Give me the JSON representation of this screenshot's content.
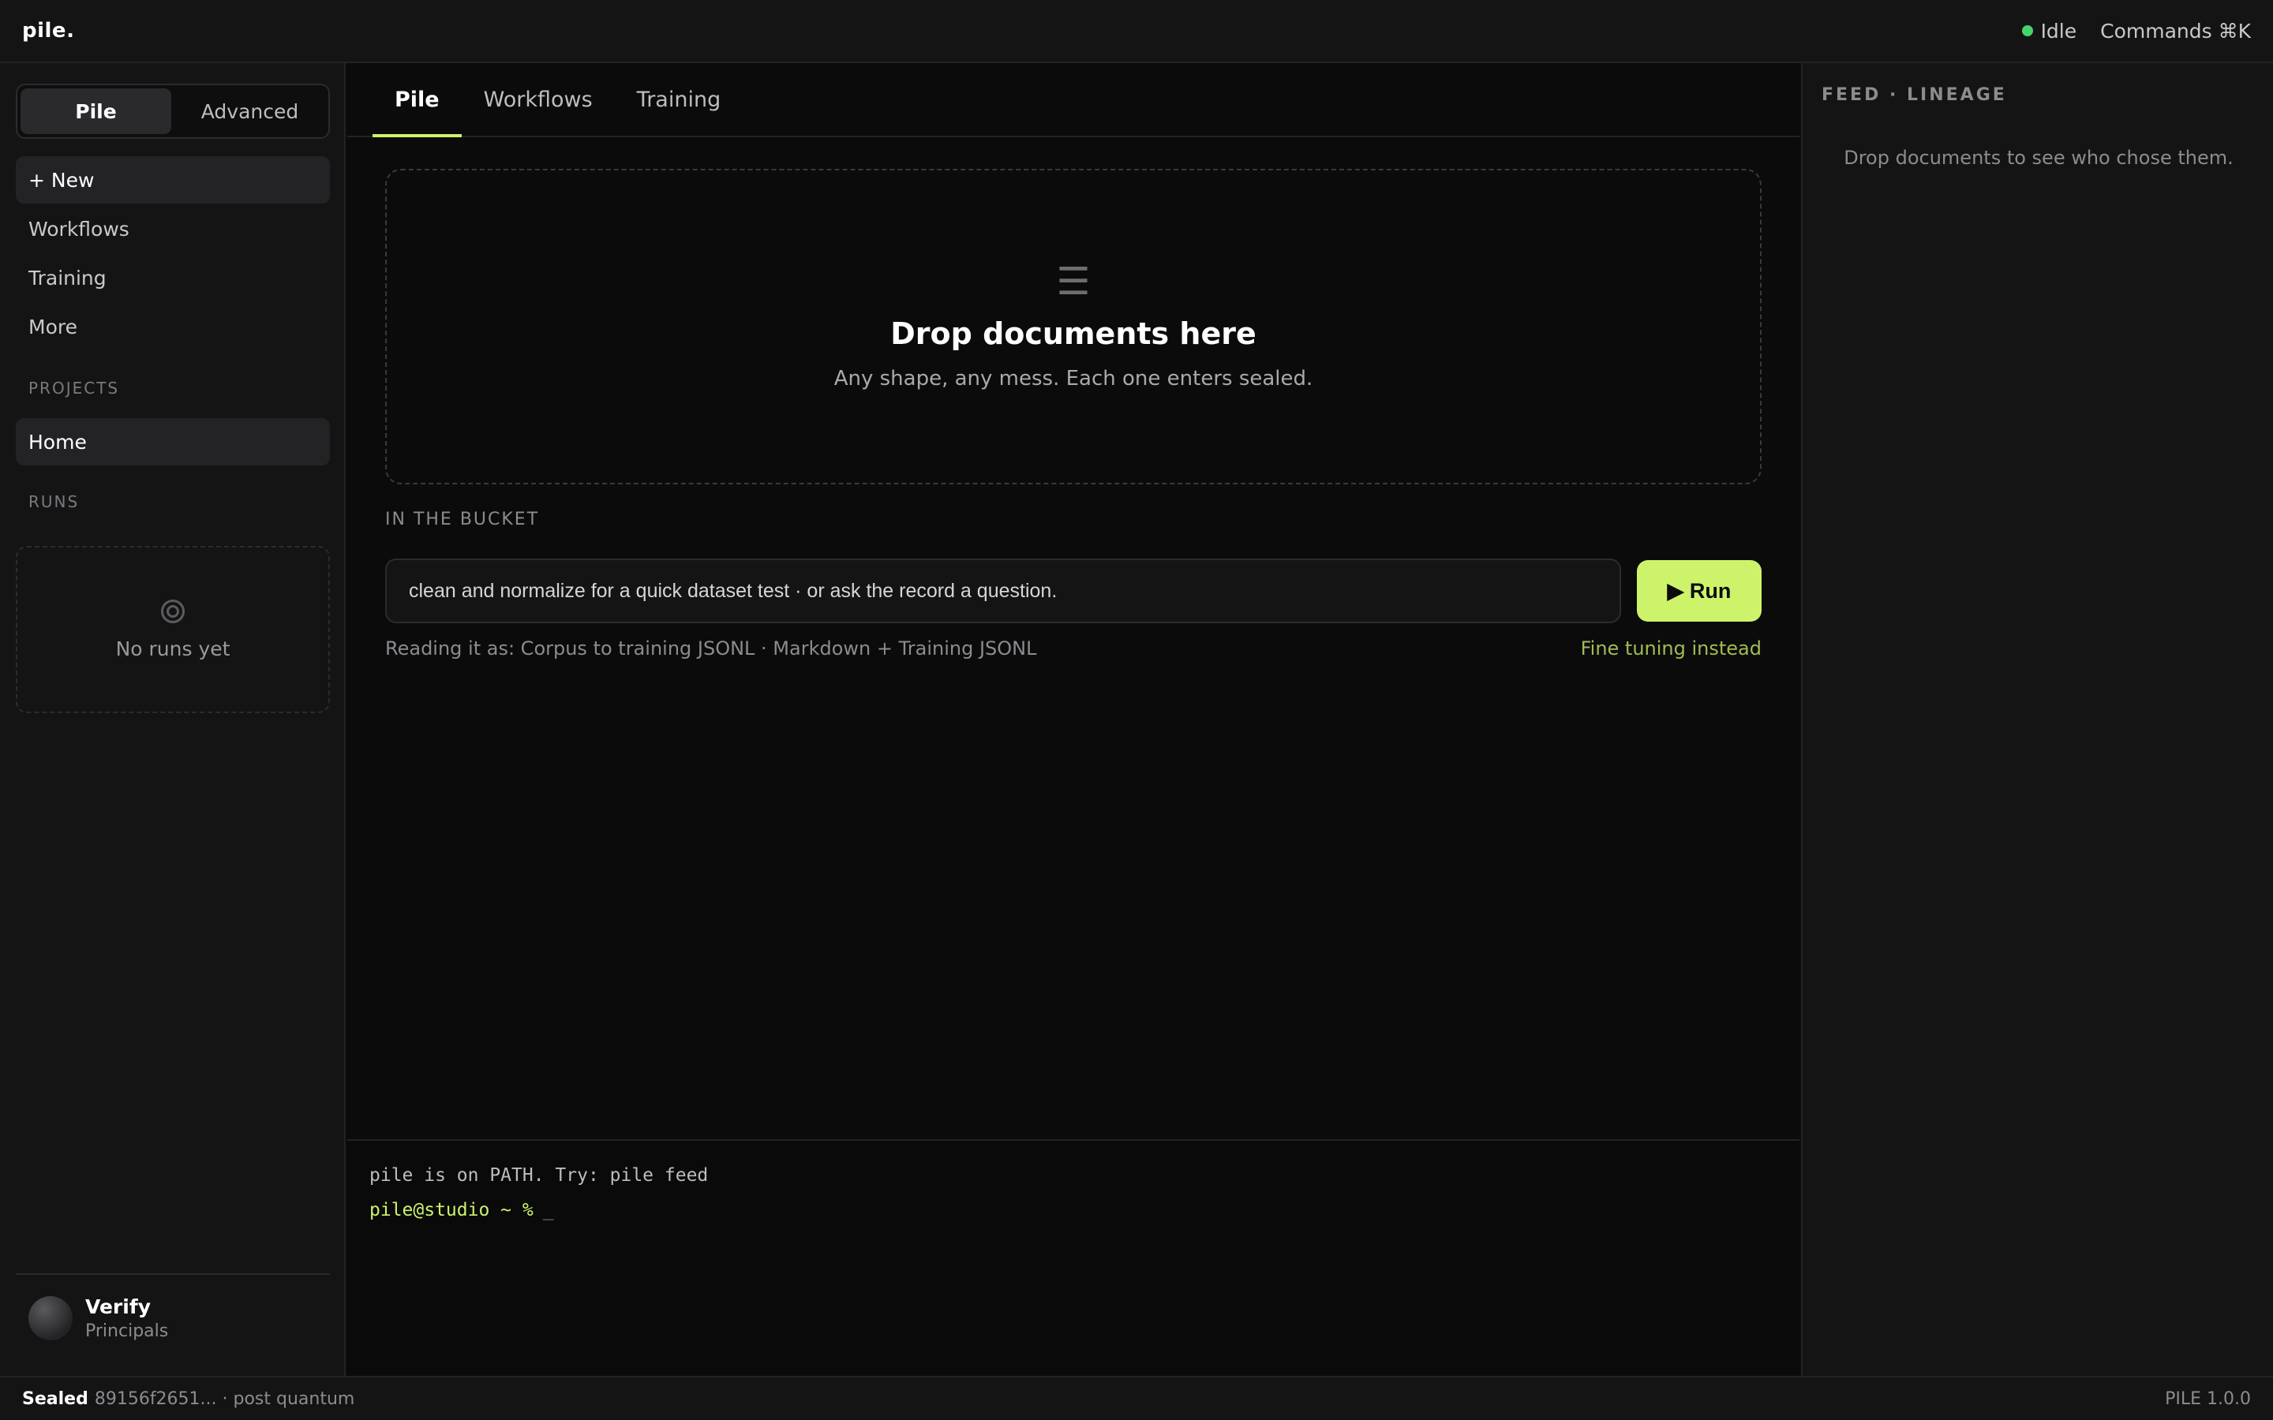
{
  "app": {
    "logo": "pile.",
    "status": "Idle",
    "commands": "Commands ⌘K",
    "colors": {
      "accent": "#cdf36b",
      "status_ok": "#46d369",
      "link": "#9fbd52"
    }
  },
  "sidebar": {
    "mode_tabs": [
      "Pile",
      "Advanced"
    ],
    "nav": [
      {
        "label": "+ New"
      },
      {
        "label": "Workflows"
      },
      {
        "label": "Training"
      },
      {
        "label": "More"
      }
    ],
    "projects_label": "PROJECTS",
    "projects": [
      {
        "label": "Home"
      }
    ],
    "runs_label": "RUNS",
    "runs_empty": "No runs yet",
    "user": {
      "name": "Verify",
      "role": "Principals"
    }
  },
  "main": {
    "tabs": [
      "Pile",
      "Workflows",
      "Training"
    ],
    "dropzone": {
      "icon": "☰",
      "title": "Drop documents here",
      "subtitle": "Any shape, any mess. Each one enters sealed."
    },
    "bucket_label": "IN THE BUCKET",
    "prompt": {
      "value": "clean and normalize for a quick dataset test · or ask the record a question."
    },
    "run_label": "▶ Run",
    "reading_as": "Reading it as: Corpus to training JSONL · Markdown + Training JSONL",
    "fine_tuning_link": "Fine tuning instead"
  },
  "terminal": {
    "line1": "pile is on PATH. Try: pile feed",
    "prompt": "pile@studio ~ %",
    "cursor": "_"
  },
  "feed": {
    "title": "FEED · LINEAGE",
    "empty": "Drop documents to see who chose them."
  },
  "footer": {
    "sealed_label": "Sealed",
    "sealed_info": "89156f2651... · post quantum",
    "version": "PILE 1.0.0"
  }
}
